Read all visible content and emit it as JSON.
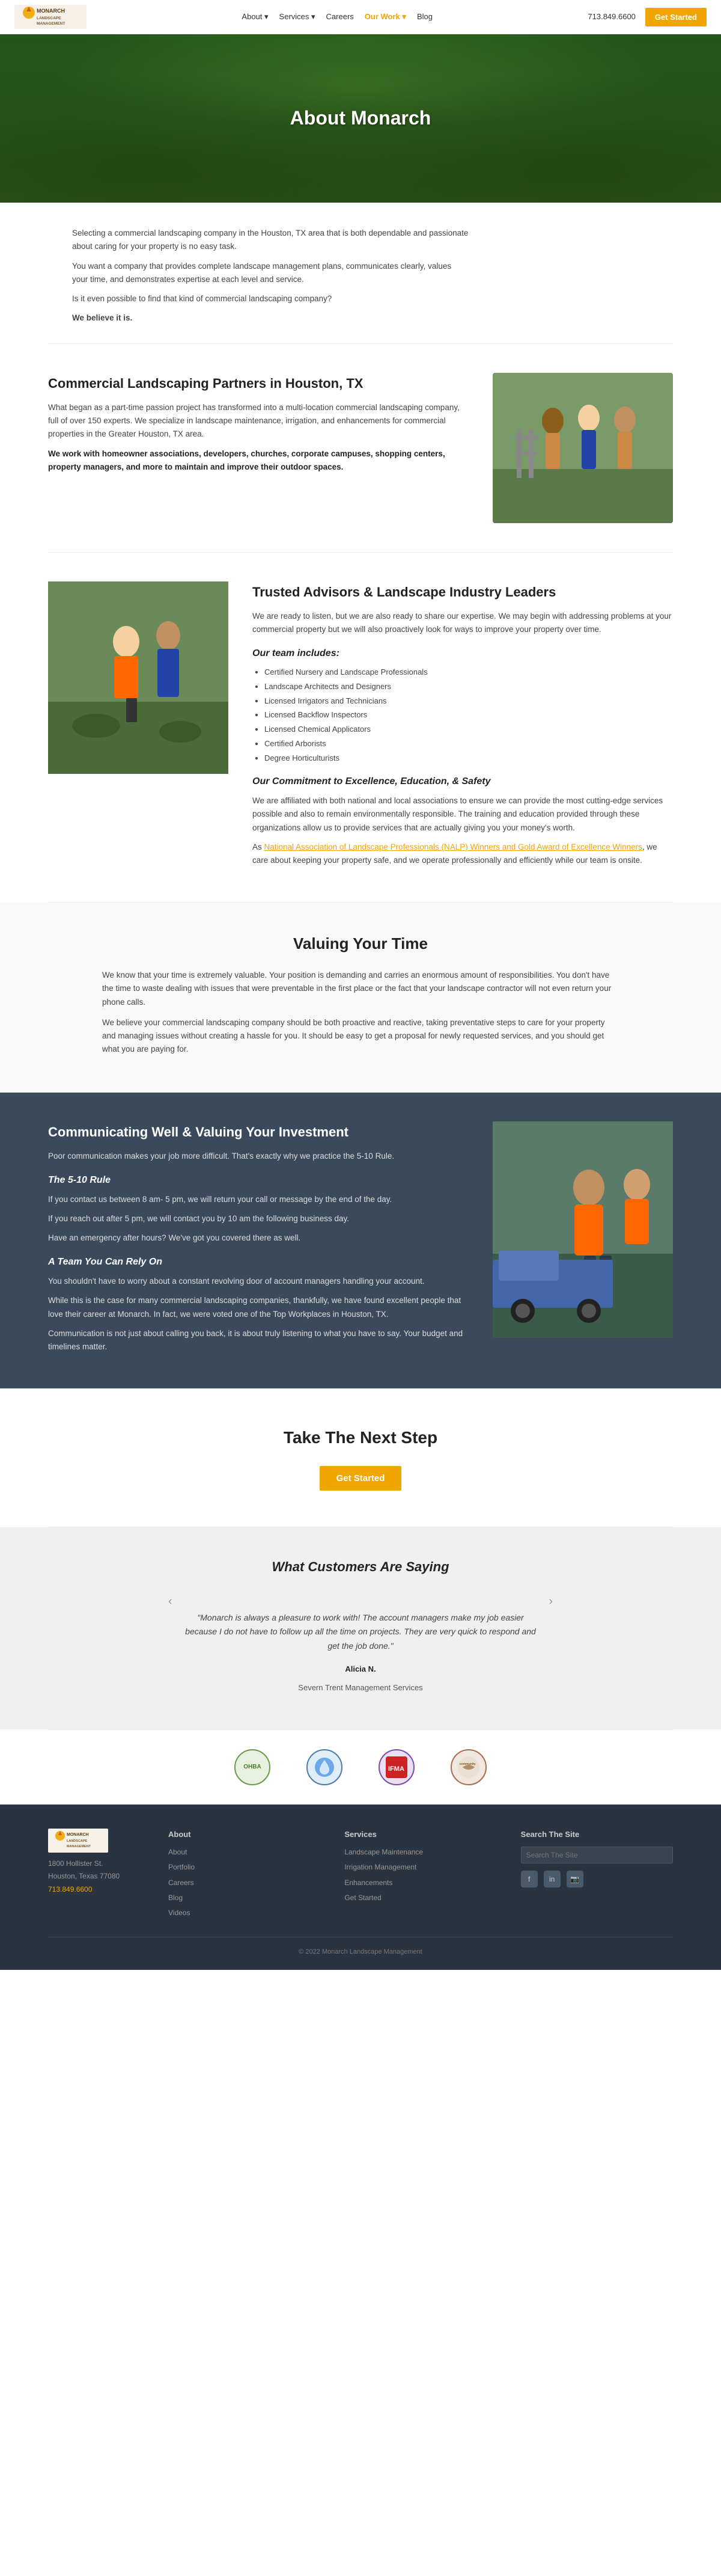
{
  "nav": {
    "logo_text": "MONARCH\nLANDSCAPE MANAGEMENT",
    "links": [
      "About",
      "Services",
      "Careers",
      "Our Work",
      "Blog"
    ],
    "our_work_label": "Our Work ▾",
    "about_label": "About ▾",
    "services_label": "Services ▾",
    "phone": "713.849.6600",
    "cta_label": "Get Started",
    "active_link": "Our Work"
  },
  "hero": {
    "title": "About Monarch"
  },
  "intro": {
    "p1": "Selecting a commercial landscaping company in the Houston, TX area that is both dependable and passionate about caring for your property is no easy task.",
    "p2": "You want a company that provides complete landscape management plans, communicates clearly, values your time, and demonstrates expertise at each level and service.",
    "p3": "Is it even possible to find that kind of commercial landscaping company?",
    "p4": "We believe it is."
  },
  "commercial": {
    "heading": "Commercial Landscaping Partners in Houston, TX",
    "p1": "What began as a part-time passion project has transformed into a multi-location commercial landscaping company, full of over 150 experts. We specialize in landscape maintenance, irrigation, and enhancements for commercial properties in the Greater Houston, TX area.",
    "bold": "We work with homeowner associations, developers, churches, corporate campuses, shopping centers, property managers, and more to maintain and improve their outdoor spaces."
  },
  "trusted": {
    "heading": "Trusted Advisors & Landscape Industry Leaders",
    "p1": "We are ready to listen, but we are also ready to share our expertise. We may begin with addressing problems at your commercial property but we will also proactively look for ways to improve your property over time.",
    "team_heading": "Our team includes:",
    "team_items": [
      "Certified Nursery and Landscape Professionals",
      "Landscape Architects and Designers",
      "Licensed Irrigators and Technicians",
      "Licensed Backflow Inspectors",
      "Licensed Chemical Applicators",
      "Certified Arborists",
      "Degree Horticulturists"
    ],
    "commitment_heading": "Our Commitment to Excellence, Education, & Safety",
    "p2": "We are affiliated with both national and local associations to ensure we can provide the most cutting-edge services possible and also to remain environmentally responsible. The training and education provided through these organizations allow us to provide services that are actually giving you your money's worth.",
    "p3_prefix": "As ",
    "link_text": "National Association of Landscape Professionals (NALP) Winners and Gold Award of Excellence Winners",
    "p3_suffix": ", we care about keeping your property safe, and we operate professionally and efficiently while our team is onsite."
  },
  "valuing": {
    "heading": "Valuing Your Time",
    "p1": "We know that your time is extremely valuable. Your position is demanding and carries an enormous amount of responsibilities. You don't have the time to waste dealing with issues that were preventable in the first place or the fact that your landscape contractor will not even return your phone calls.",
    "p2": "We believe your commercial landscaping company should be both proactive and reactive, taking preventative steps to care for your property and managing issues without creating a hassle for you. It should be easy to get a proposal for newly requested services, and you should get what you are paying for."
  },
  "communicating": {
    "heading": "Communicating Well & Valuing Your Investment",
    "p1": "Poor communication makes your job more difficult. That's exactly why we practice the 5-10 Rule.",
    "rule_heading": "The 5-10 Rule",
    "p2": "If you contact us between 8 am- 5 pm, we will return your call or message by the end of the day.",
    "p3": "If you reach out after 5 pm, we will contact you by 10 am the following business day.",
    "p4": "Have an emergency after hours? We've got you covered there as well.",
    "team_heading": "A Team You Can Rely On",
    "p5": "You shouldn't have to worry about a constant revolving door of account managers handling your account.",
    "p6": "While this is the case for many commercial landscaping companies, thankfully, we have found excellent people that love their career at Monarch. In fact, we were voted one of the Top Workplaces in Houston, TX.",
    "p7": "Communication is not just about calling you back, it is about truly listening to what you have to say. Your budget and timelines matter."
  },
  "next_step": {
    "heading": "Take The Next Step",
    "cta_label": "Get Started"
  },
  "testimonials": {
    "heading": "What Customers Are Saying",
    "quote": "\"Monarch is always a pleasure to work with! The account managers make my job easier because I do not have to follow up all the time on projects. They are very quick to respond and get the job done.\"",
    "author": "Alicia N.",
    "company": "Severn Trent Management Services"
  },
  "logos": [
    {
      "name": "OHBA",
      "label": "OHBA"
    },
    {
      "name": "Water",
      "label": ""
    },
    {
      "name": "IFMA",
      "label": "IFMA"
    },
    {
      "name": "community",
      "label": "community"
    }
  ],
  "footer": {
    "logo_text": "MONARCH\nLANDSCAPE MANAGEMENT",
    "address": "1800 Hollister St.\nHouston, Texas 77080",
    "phone": "713.849.6600",
    "about_heading": "About",
    "about_links": [
      "About",
      "Portfolio",
      "Careers",
      "Blog",
      "Videos"
    ],
    "services_heading": "Services",
    "services_links": [
      "Landscape Maintenance",
      "Irrigation Management",
      "Enhancements",
      "Get Started"
    ],
    "search_heading": "Search The Site",
    "search_placeholder": "Search The Site",
    "social_icons": [
      "f",
      "in",
      "📷"
    ],
    "copyright": "© 2022 Monarch Landscape Management"
  }
}
